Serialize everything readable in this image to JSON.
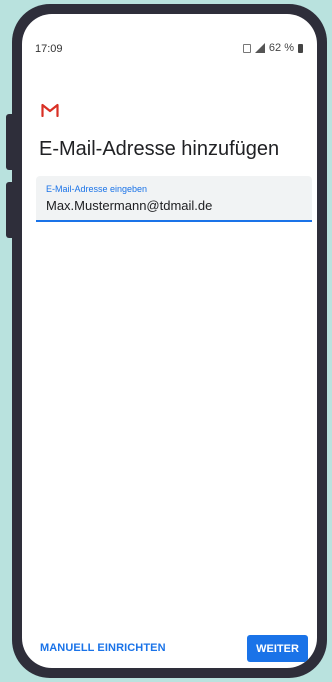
{
  "status_bar": {
    "time": "17:09",
    "battery_percent": "62 %",
    "icons": [
      "vibrate-icon",
      "signal-icon",
      "battery-icon"
    ]
  },
  "app": {
    "logo_icon": "gmail-icon",
    "title": "E-Mail-Adresse hinzufügen"
  },
  "email_input": {
    "label": "E-Mail-Adresse eingeben",
    "value": "Max.Mustermann@tdmail.de"
  },
  "actions": {
    "manual_label": "MANUELL EINRICHTEN",
    "next_label": "WEITER"
  },
  "colors": {
    "accent": "#1a73e8",
    "gmail_red": "#d93025",
    "background": "#b9e2de",
    "frame": "#2e2e3a",
    "field_bg": "#f1f3f4"
  }
}
